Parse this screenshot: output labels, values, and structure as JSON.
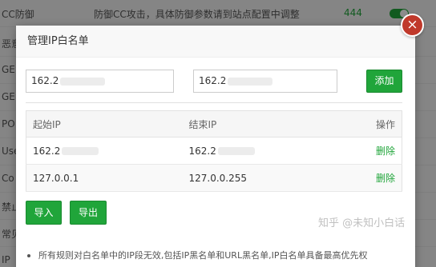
{
  "background": {
    "rows": [
      {
        "label": "CC防御",
        "desc": "防御CC攻击，具体防御参数请到站点配置中调整",
        "value": "444"
      },
      {
        "label": "恶意",
        "desc": "",
        "value": ""
      },
      {
        "label": "GE",
        "desc": "",
        "value": ""
      },
      {
        "label": "GE",
        "desc": "",
        "value": ""
      },
      {
        "label": "PO",
        "desc": "",
        "value": ""
      },
      {
        "label": "Use",
        "desc": "",
        "value": ""
      },
      {
        "label": "Co",
        "desc": "",
        "value": ""
      },
      {
        "label": "禁止",
        "desc": "",
        "value": ""
      },
      {
        "label": "常见",
        "desc": "",
        "value": ""
      },
      {
        "label": "IP",
        "desc": "",
        "value": ""
      }
    ]
  },
  "modal": {
    "title": "管理IP白名单",
    "close_icon": "×",
    "start_ip_value": "162.2",
    "end_ip_value": "162.2",
    "add_label": "添加",
    "table": {
      "headers": [
        "起始IP",
        "结束IP",
        "操作"
      ],
      "rows": [
        {
          "start": "162.2",
          "end": "162.2",
          "action": "删除"
        },
        {
          "start": "127.0.0.1",
          "end": "127.0.0.255",
          "action": "删除"
        }
      ]
    },
    "import_label": "导入",
    "export_label": "导出",
    "note": "所有规则对白名单中的IP段无效,包括IP黑名单和URL黑名单,IP白名单具备最高优先权"
  },
  "watermark": "知乎 @未知小白话",
  "colors": {
    "accent": "#20a53a",
    "close": "#c0392b"
  }
}
